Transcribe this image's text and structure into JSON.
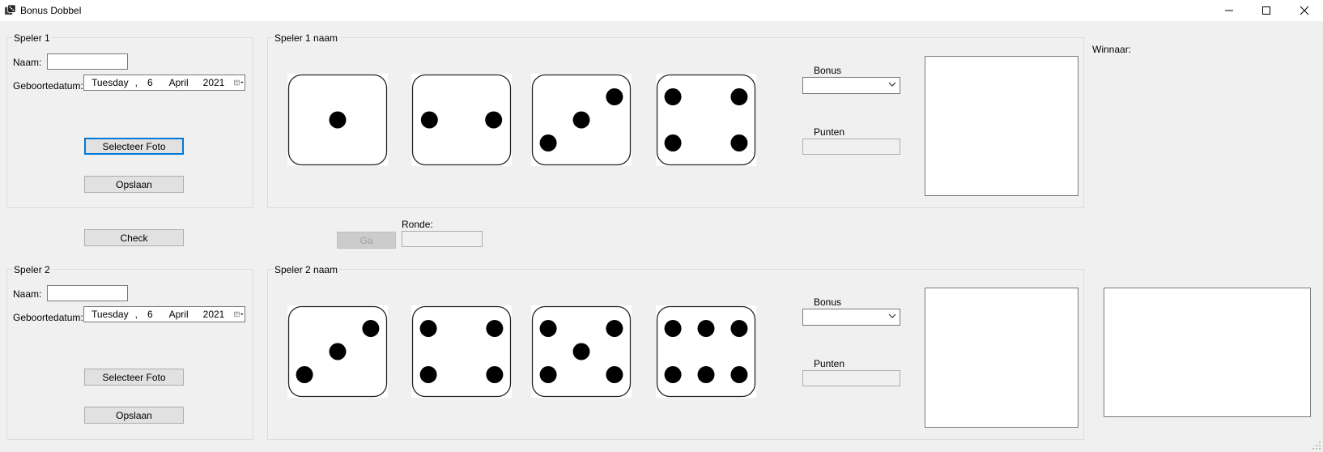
{
  "window": {
    "title": "Bonus Dobbel"
  },
  "speler1": {
    "legend": "Speler 1",
    "naam_label": "Naam:",
    "naam_value": "",
    "geboortedatum_label": "Geboortedatum:",
    "date": {
      "weekday": "Tuesday",
      "sep": ",",
      "day": "6",
      "month": "April",
      "year": "2021"
    },
    "select_photo_label": "Selecteer Foto",
    "save_label": "Opslaan"
  },
  "speler2": {
    "legend": "Speler 2",
    "naam_label": "Naam:",
    "naam_value": "",
    "geboortedatum_label": "Geboortedatum:",
    "date": {
      "weekday": "Tuesday",
      "sep": ",",
      "day": "6",
      "month": "April",
      "year": "2021"
    },
    "select_photo_label": "Selecteer Foto",
    "save_label": "Opslaan"
  },
  "board1": {
    "legend": "Speler 1 naam",
    "dice": [
      1,
      2,
      3,
      4
    ],
    "bonus_label": "Bonus",
    "bonus_value": "",
    "punten_label": "Punten",
    "punten_value": ""
  },
  "board2": {
    "legend": "Speler 2 naam",
    "dice": [
      3,
      4,
      5,
      6
    ],
    "bonus_label": "Bonus",
    "bonus_value": "",
    "punten_label": "Punten",
    "punten_value": ""
  },
  "controls": {
    "check_label": "Check",
    "ga_label": "Ga",
    "ronde_label": "Ronde:",
    "ronde_value": ""
  },
  "winner": {
    "label": "Winnaar:"
  }
}
